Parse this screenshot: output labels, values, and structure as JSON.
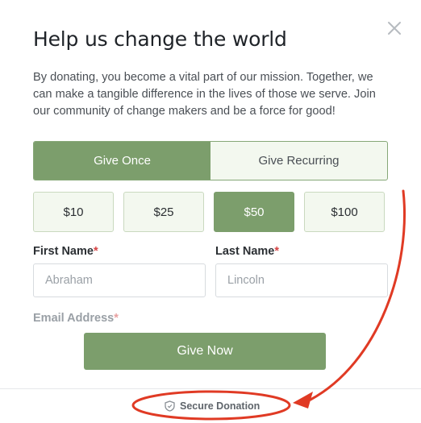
{
  "modal": {
    "title": "Help us change the world",
    "description": "By donating, you become a vital part of our mission. Together, we can make a tangible difference in the lives of those we serve. Join our community of change makers and be a force for good!"
  },
  "frequency": {
    "once_label": "Give Once",
    "recurring_label": "Give Recurring",
    "selected": "Give Once"
  },
  "amounts": [
    {
      "label": "$10"
    },
    {
      "label": "$25"
    },
    {
      "label": "$50"
    },
    {
      "label": "$100"
    }
  ],
  "selected_amount": "$50",
  "form": {
    "first_name_label": "First Name",
    "first_name_placeholder": "Abraham",
    "last_name_label": "Last Name",
    "last_name_placeholder": "Lincoln",
    "email_label": "Email Address",
    "required_marker": "*"
  },
  "submit_label": "Give Now",
  "footer": {
    "secure_label": "Secure Donation",
    "secure_icon": "shield-icon"
  },
  "colors": {
    "accent": "#7c9e6c",
    "accent_light": "#f3f8ef",
    "annotation": "#e03a24"
  }
}
